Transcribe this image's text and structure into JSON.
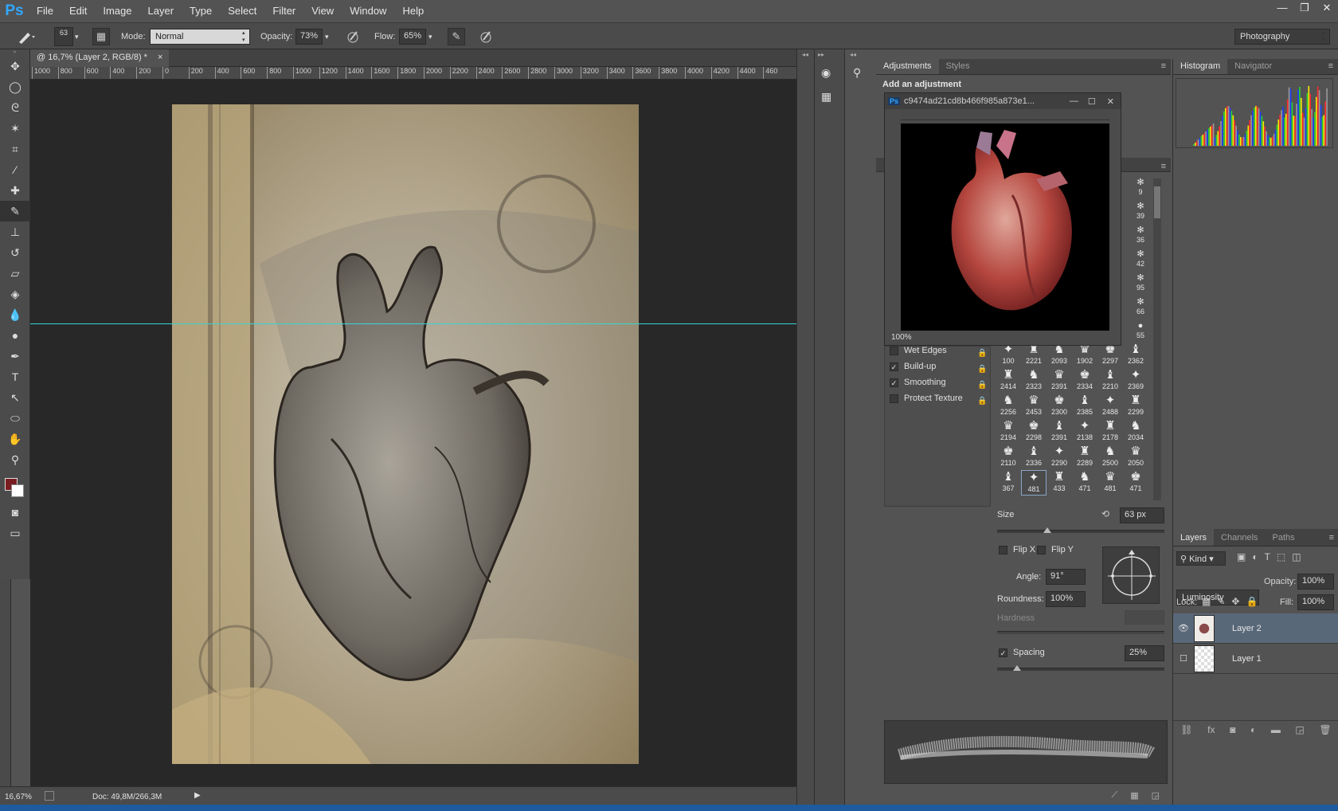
{
  "app": {
    "logo": "Ps"
  },
  "menu": [
    "File",
    "Edit",
    "Image",
    "Layer",
    "Type",
    "Select",
    "Filter",
    "View",
    "Window",
    "Help"
  ],
  "window_controls": {
    "minimize": "—",
    "restore": "❐",
    "close": "✕"
  },
  "options_bar": {
    "brush_size": "63",
    "mode_label": "Mode:",
    "mode_value": "Normal",
    "opacity_label": "Opacity:",
    "opacity_value": "73%",
    "flow_label": "Flow:",
    "flow_value": "65%",
    "workspace": "Photography"
  },
  "document": {
    "tab_title": "@ 16,7% (Layer 2, RGB/8) *",
    "close": "×",
    "ruler_ticks": [
      "1000",
      "800",
      "600",
      "400",
      "200",
      "0",
      "200",
      "400",
      "600",
      "800",
      "1000",
      "1200",
      "1400",
      "1600",
      "1800",
      "2000",
      "2200",
      "2400",
      "2600",
      "2800",
      "3000",
      "3200",
      "3400",
      "3600",
      "3800",
      "4000",
      "4200",
      "4400",
      "460"
    ]
  },
  "status": {
    "zoom": "16,67%",
    "doc": "Doc: 49,8M/266,3M"
  },
  "adjustments": {
    "tabs": [
      "Adjustments",
      "Styles"
    ],
    "heading": "Add an adjustment"
  },
  "float_window": {
    "title": "c9474ad21cd8b466f985a873e1...",
    "zoom": "100%"
  },
  "brush_options": {
    "checkboxes": [
      {
        "label": "Wet Edges",
        "checked": false
      },
      {
        "label": "Build-up",
        "checked": true
      },
      {
        "label": "Smoothing",
        "checked": true
      },
      {
        "label": "Protect Texture",
        "checked": false
      }
    ],
    "size_label": "Size",
    "size_value": "63 px",
    "size_fraction": 0.3,
    "flipx": "Flip X",
    "flipy": "Flip Y",
    "angle_label": "Angle:",
    "angle_value": "91°",
    "roundness_label": "Roundness:",
    "roundness_value": "100%",
    "hardness_label": "Hardness",
    "spacing_label": "Spacing",
    "spacing_value": "25%",
    "spacing_fraction": 0.12
  },
  "brush_column": [
    "9",
    "39",
    "36",
    "42",
    "95",
    "66",
    "55"
  ],
  "brush_grid": [
    [
      "100",
      "2221",
      "2093",
      "1902",
      "2297",
      "2362"
    ],
    [
      "2414",
      "2323",
      "2391",
      "2334",
      "2210",
      "2369"
    ],
    [
      "2256",
      "2453",
      "2300",
      "2385",
      "2488",
      "2299"
    ],
    [
      "2194",
      "2298",
      "2391",
      "2138",
      "2178",
      "2034"
    ],
    [
      "2110",
      "2336",
      "2290",
      "2289",
      "2500",
      "2050"
    ],
    [
      "367",
      "481",
      "433",
      "471",
      "481",
      "471"
    ]
  ],
  "right_panel": {
    "top_tabs": [
      "Histogram",
      "Navigator"
    ],
    "layer_tabs": [
      "Layers",
      "Channels",
      "Paths"
    ],
    "kind": "Kind",
    "blend": "Luminosity",
    "opacity_label": "Opacity:",
    "opacity_value": "100%",
    "lock_label": "Lock:",
    "fill_label": "Fill:",
    "fill_value": "100%",
    "layers": [
      {
        "name": "Layer 2",
        "visible": true,
        "selected": true
      },
      {
        "name": "Layer 1",
        "visible": false,
        "selected": false
      }
    ]
  },
  "colors": {
    "foreground": "#7a1d22",
    "background": "#ffffff",
    "guide": "#34d6d6"
  }
}
